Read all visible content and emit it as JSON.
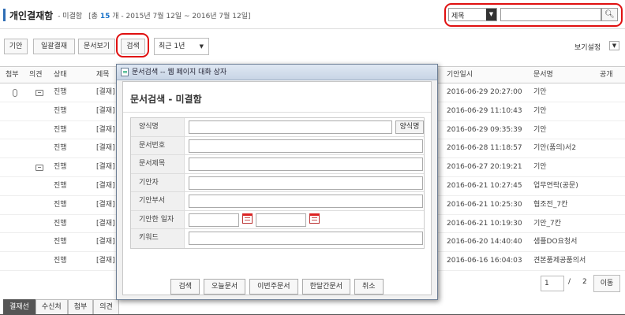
{
  "header": {
    "title": "개인결재함",
    "subtitle": "- 미결함",
    "meta_prefix": "[총",
    "meta_count": "15",
    "meta_suffix": "개 - 2015년 7월 12일 ~ 2016년 7월 12일]"
  },
  "search": {
    "field_selected": "제목",
    "query": ""
  },
  "toolbar": {
    "draft": "기안",
    "bulk_approve": "일괄결재",
    "view_doc": "문서보기",
    "search": "검색",
    "period": "최근 1년",
    "view_settings": "보기설정"
  },
  "table": {
    "headers": [
      "첨부",
      "의견",
      "상태",
      "제목",
      "기안일시",
      "문서명",
      "공개"
    ],
    "rows": [
      {
        "status": "진행",
        "title": "[결재]",
        "date": "2016-06-29 20:27:00",
        "doc": "기안",
        "attach": true,
        "comment": true
      },
      {
        "status": "진행",
        "title": "[결재]",
        "date": "2016-06-29 11:10:43",
        "doc": "기안",
        "attach": false,
        "comment": false
      },
      {
        "status": "진행",
        "title": "[결재]",
        "date": "2016-06-29 09:35:39",
        "doc": "기안",
        "attach": false,
        "comment": false
      },
      {
        "status": "진행",
        "title": "[결재]",
        "date": "2016-06-28 11:18:57",
        "doc": "기안(품의)서2",
        "attach": false,
        "comment": false
      },
      {
        "status": "진행",
        "title": "[결재]",
        "date": "2016-06-27 20:19:21",
        "doc": "기안",
        "attach": false,
        "comment": true
      },
      {
        "status": "진행",
        "title": "[결재]",
        "date": "2016-06-21 10:27:45",
        "doc": "업무연락(공문)",
        "attach": false,
        "comment": false
      },
      {
        "status": "진행",
        "title": "[결재]",
        "date": "2016-06-21 10:25:30",
        "doc": "협조전_7칸",
        "attach": false,
        "comment": false
      },
      {
        "status": "진행",
        "title": "[결재]",
        "date": "2016-06-21 10:19:30",
        "doc": "기안_7칸",
        "attach": false,
        "comment": false
      },
      {
        "status": "진행",
        "title": "[결재]",
        "date": "2016-06-20 14:40:40",
        "doc": "샘플DO요청서",
        "attach": false,
        "comment": false
      },
      {
        "status": "진행",
        "title": "[결재]",
        "date": "2016-06-16 16:04:03",
        "doc": "견본품제공품의서",
        "attach": false,
        "comment": false
      }
    ]
  },
  "pager": {
    "current": "1",
    "slash": "/",
    "total": "2",
    "go": "이동"
  },
  "bottom_tabs": [
    "결재선",
    "수신처",
    "첨부",
    "의견"
  ],
  "dialog": {
    "window_title": "문서검색 -- 웹 페이지 대화 상자",
    "heading": "문서검색 - 미결함",
    "fields": {
      "form_name": "양식명",
      "form_name_button": "양식명",
      "doc_number": "문서번호",
      "doc_title": "문서제목",
      "drafter": "기안자",
      "drafter_dept": "기안부서",
      "draft_date": "기안한 일자",
      "keyword": "키워드"
    },
    "buttons": {
      "search": "검색",
      "today": "오늘문서",
      "this_week": "이번주문서",
      "this_month": "한달간문서",
      "cancel": "취소"
    }
  },
  "colors": {
    "accent": "#2e6db4",
    "highlight": "#e01010",
    "count": "#1a73c9"
  }
}
